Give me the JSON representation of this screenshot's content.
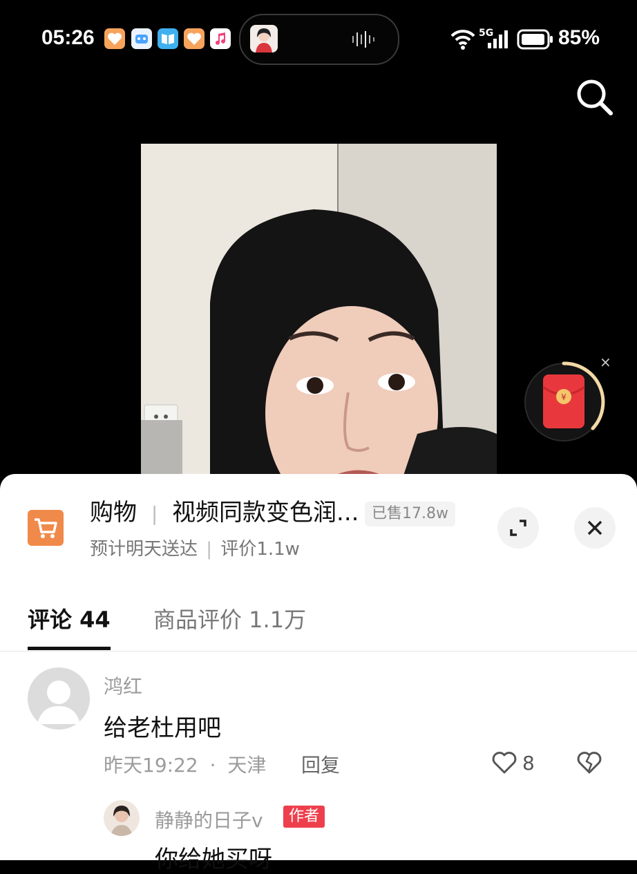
{
  "status_bar": {
    "time": "05:26",
    "network": "5G",
    "battery": "85%"
  },
  "product": {
    "category": "购物",
    "title": "视频同款变色润...",
    "sold": "已售17.8w",
    "delivery": "预计明天送达",
    "rating": "评价1.1w"
  },
  "tabs": [
    {
      "label": "评论 44",
      "active": true
    },
    {
      "label": "商品评价 1.1万",
      "active": false
    }
  ],
  "comments": [
    {
      "user": "鸿红",
      "text": "给老杜用吧",
      "time": "昨天19:22",
      "location": "天津",
      "reply_label": "回复",
      "likes": "8"
    }
  ],
  "replies": [
    {
      "user": "静静的日子v",
      "badge": "作者",
      "text": "你给她买呀"
    }
  ],
  "colors": {
    "cart_orange": "#f08a4b",
    "author_badge": "#ee3f4d",
    "redpacket": "#e8383d"
  }
}
